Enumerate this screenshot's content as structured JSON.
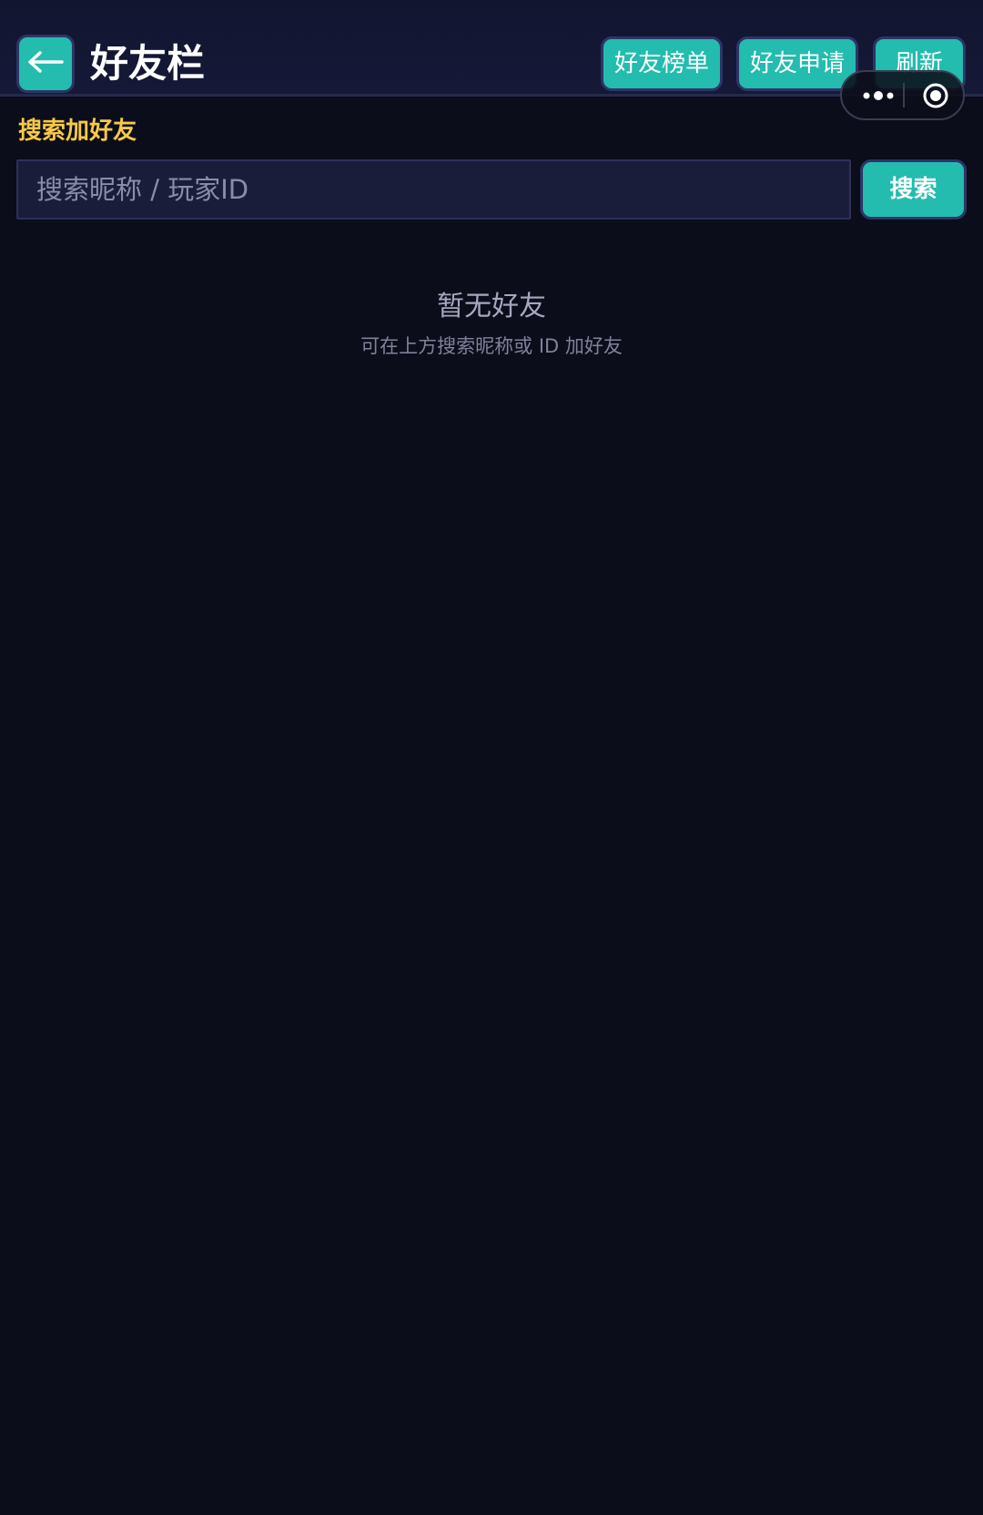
{
  "header": {
    "title": "好友栏",
    "buttons": {
      "leaderboard": "好友榜单",
      "requests": "好友申请",
      "refresh": "刷新"
    }
  },
  "icons": {
    "back": "arrow-left-icon",
    "more": "more-dots-icon",
    "close": "target-circle-icon"
  },
  "search": {
    "section_label": "搜索加好友",
    "placeholder": "搜索昵称 / 玩家ID",
    "value": "",
    "button_label": "搜索"
  },
  "empty_state": {
    "title": "暂无好友",
    "hint": "可在上方搜索昵称或 ID 加好友"
  },
  "colors": {
    "background": "#0b0d1b",
    "accent": "#23bcae",
    "label": "#f7c948",
    "input_bg": "#1a1d3a"
  }
}
